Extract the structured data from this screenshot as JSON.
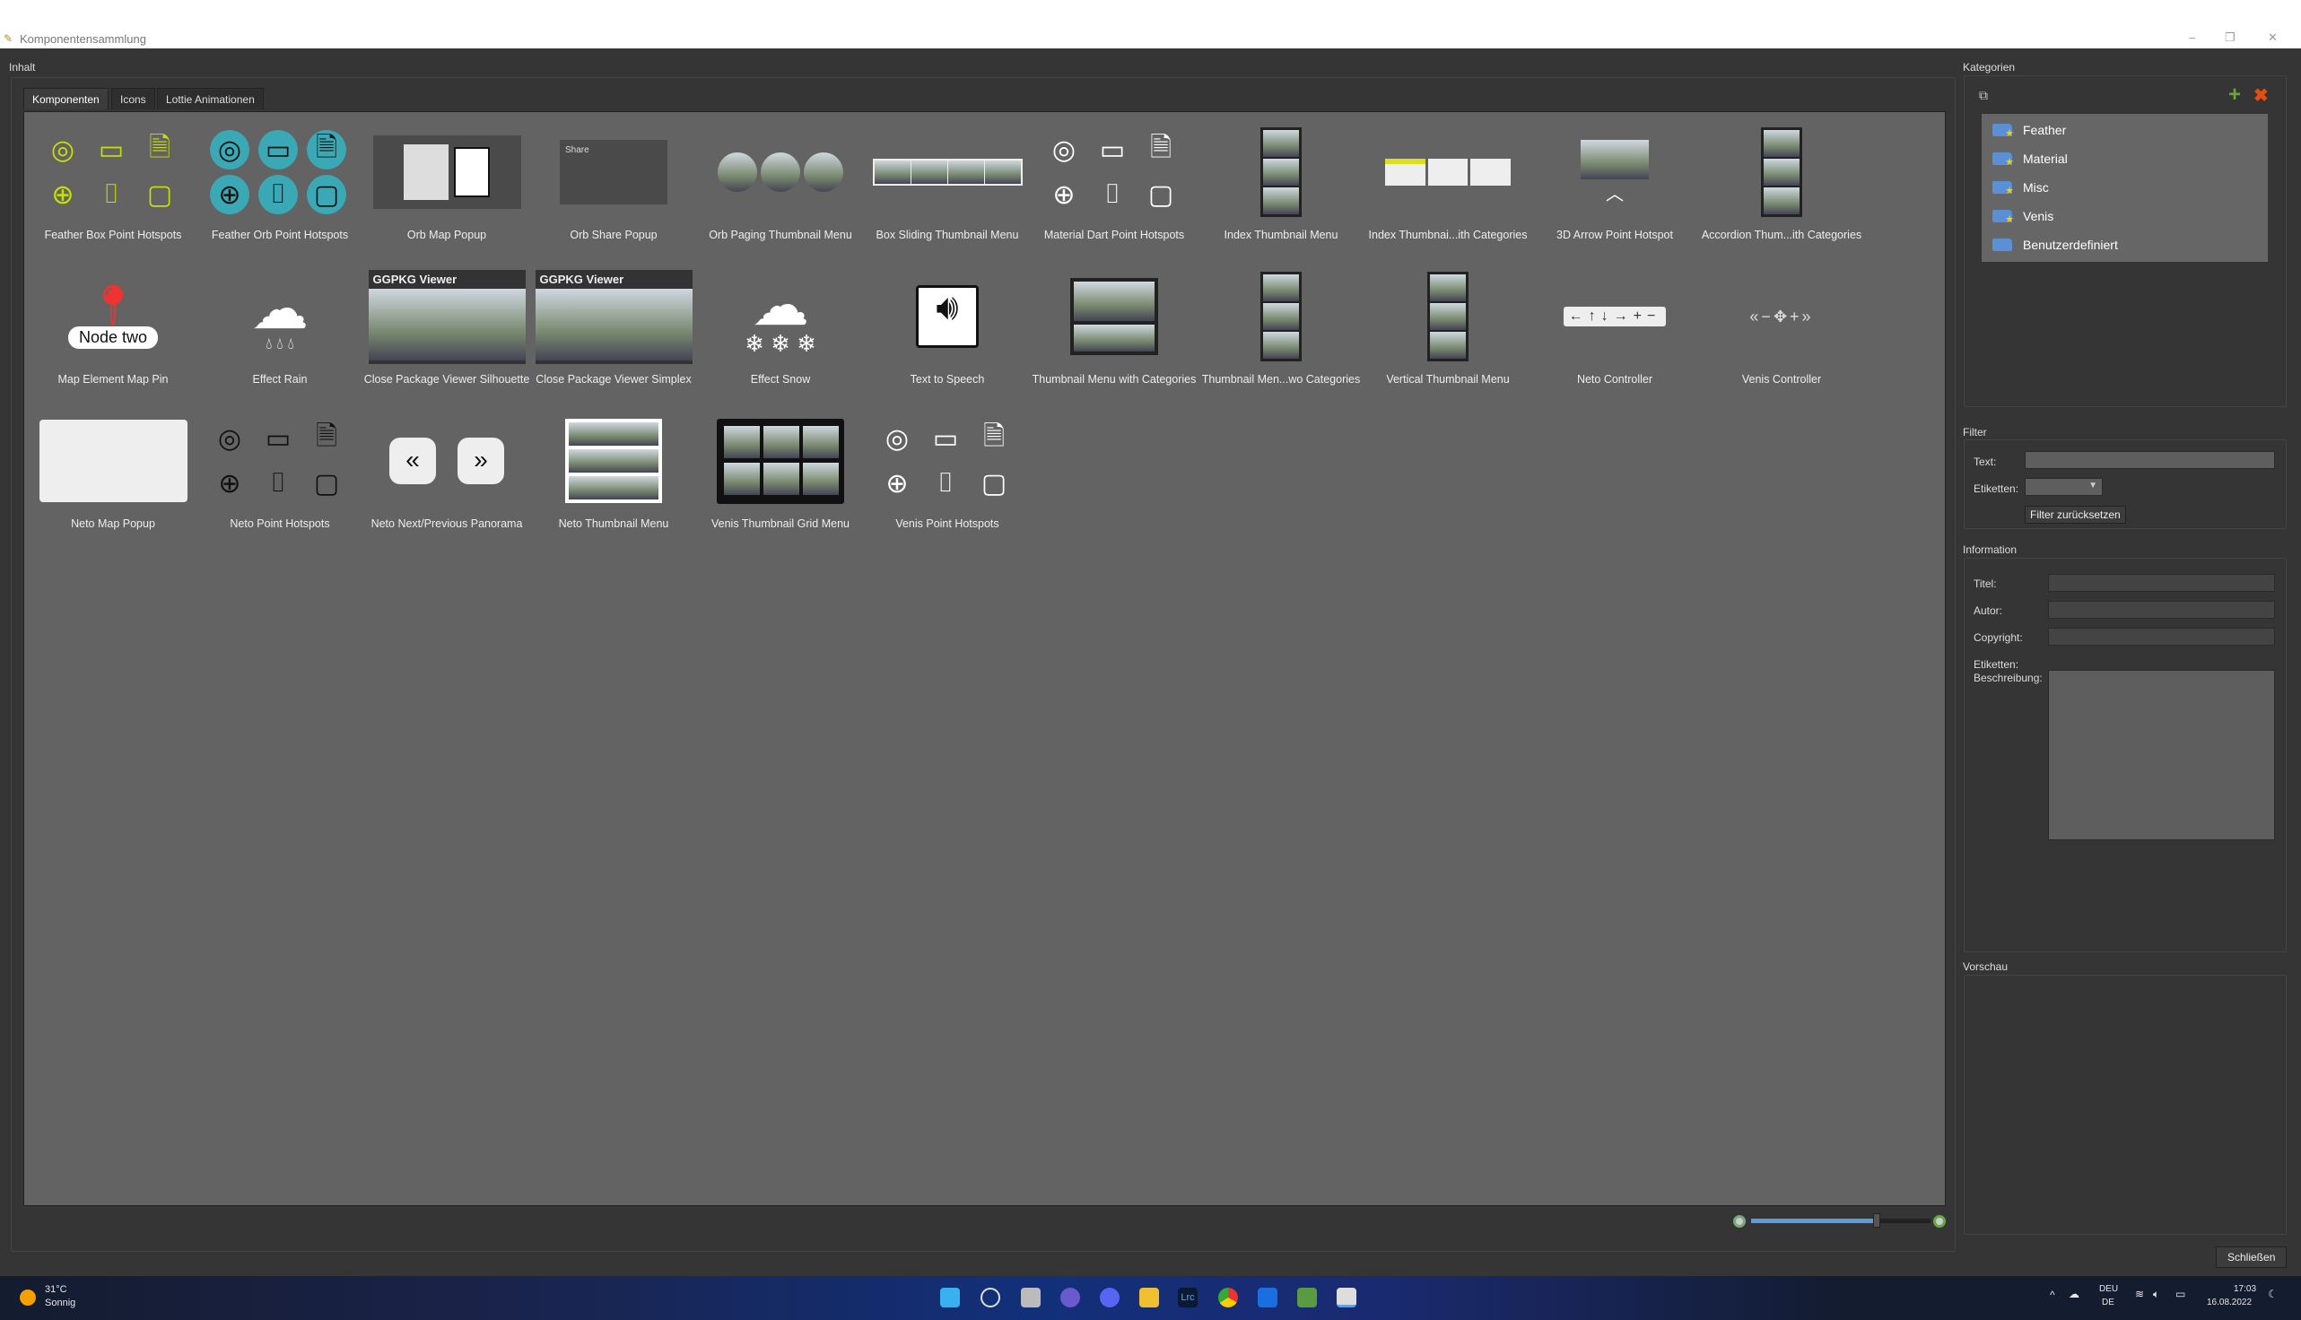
{
  "window": {
    "title": "Komponentensammlung"
  },
  "content": {
    "section_title": "Inhalt",
    "tabs": [
      {
        "label": "Komponenten",
        "active": true
      },
      {
        "label": "Icons"
      },
      {
        "label": "Lottie Animationen"
      }
    ],
    "items": [
      {
        "label": "Feather Box Point Hotspots",
        "thumb": "icons-lime"
      },
      {
        "label": "Feather Orb Point Hotspots",
        "thumb": "icons-orb"
      },
      {
        "label": "Orb Map Popup",
        "thumb": "map-popup"
      },
      {
        "label": "Orb Share Popup",
        "thumb": "share",
        "text": "Share"
      },
      {
        "label": "Orb Paging Thumbnail Menu",
        "thumb": "orbs"
      },
      {
        "label": "Box Sliding Thumbnail Menu",
        "thumb": "strip"
      },
      {
        "label": "Material Dart Point Hotspots",
        "thumb": "icons-white"
      },
      {
        "label": "Index Thumbnail Menu",
        "thumb": "vstrip"
      },
      {
        "label": "Index Thumbnai...ith Categories",
        "thumb": "index-cat"
      },
      {
        "label": "3D Arrow Point Hotspot",
        "thumb": "arrow3d"
      },
      {
        "label": "Accordion Thum...ith Categories",
        "thumb": "vstrip"
      },
      {
        "label": "Map Element Map Pin",
        "thumb": "pin",
        "text": "Node two"
      },
      {
        "label": "Effect Rain",
        "thumb": "rain"
      },
      {
        "label": "Close Package Viewer Silhouette",
        "thumb": "viewer",
        "text": "GGPKG Viewer"
      },
      {
        "label": "Close Package Viewer Simplex",
        "thumb": "viewer2",
        "text": "GGPKG Viewer"
      },
      {
        "label": "Effect Snow",
        "thumb": "snow"
      },
      {
        "label": "Text to Speech",
        "thumb": "tts"
      },
      {
        "label": "Thumbnail Menu with Categories",
        "thumb": "thumbcat"
      },
      {
        "label": "Thumbnail Men...wo Categories",
        "thumb": "vstrip"
      },
      {
        "label": "Vertical Thumbnail Menu",
        "thumb": "vstrip"
      },
      {
        "label": "Neto Controller",
        "thumb": "neto-ctrl"
      },
      {
        "label": "Venis Controller",
        "thumb": "venis-ctrl"
      },
      {
        "label": "Neto Map Popup",
        "thumb": "neto-map"
      },
      {
        "label": "Neto Point Hotspots",
        "thumb": "icons-line"
      },
      {
        "label": "Neto Next/Previous Panorama",
        "thumb": "nextprev"
      },
      {
        "label": "Neto Thumbnail Menu",
        "thumb": "neto-thumb"
      },
      {
        "label": "Venis Thumbnail Grid Menu",
        "thumb": "grid"
      },
      {
        "label": "Venis Point Hotspots",
        "thumb": "icons-white2"
      }
    ],
    "zoom_slider": {
      "value_percent": 70
    }
  },
  "categories": {
    "title": "Kategorien",
    "items": [
      {
        "label": "Feather",
        "starred": true
      },
      {
        "label": "Material",
        "starred": true
      },
      {
        "label": "Misc",
        "starred": true
      },
      {
        "label": "Venis",
        "starred": true
      },
      {
        "label": "Benutzerdefiniert",
        "starred": false
      }
    ]
  },
  "filter": {
    "title": "Filter",
    "text_label": "Text:",
    "text_value": "",
    "tags_label": "Etiketten:",
    "reset_button": "Filter zurücksetzen"
  },
  "information": {
    "title": "Information",
    "fields": [
      "Titel:",
      "Autor:",
      "Copyright:",
      "Etiketten:"
    ],
    "description_label": "Beschreibung:"
  },
  "preview": {
    "title": "Vorschau"
  },
  "close_button": "Schließen",
  "taskbar": {
    "temperature": "31°C",
    "weather": "Sonnig",
    "lang1": "DEU",
    "lang2": "DE",
    "time": "17:03",
    "date": "16.08.2022"
  },
  "colors": {
    "lime": "#c8e000",
    "teal": "#3aa9b5",
    "panel": "#353535",
    "content": "#636363"
  }
}
